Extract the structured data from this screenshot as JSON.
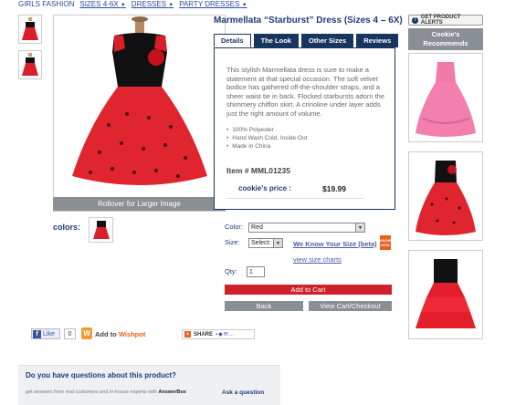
{
  "breadcrumb": {
    "items": [
      "GIRLS FASHION",
      "SIZES 4-6X",
      "DRESSES",
      "PARTY DRESSES"
    ]
  },
  "product": {
    "title": "Marmellata “Starburst” Dress (Sizes 4 – 6X)",
    "rollover": "Rollover for Larger Image",
    "colors_label": "colors:"
  },
  "tabs": [
    {
      "label": "Details",
      "active": true
    },
    {
      "label": "The Look",
      "active": false
    },
    {
      "label": "Other Sizes",
      "active": false
    },
    {
      "label": "Reviews",
      "active": false
    }
  ],
  "details": {
    "description": "This stylish Marmellata dress is sure to make a statement at that special occasion. The soft velvet bodice has gathered off-the-shoulder straps, and a sheer waist tie in back. Flocked starbursts adorn the shimmery chiffon skirt. A crinoline under layer adds just the right amount of volume.",
    "bullets": [
      "100% Polyester",
      "Hand Wash Cold, Inside Out",
      "Made in China"
    ],
    "item_number": "Item # MML01235",
    "price_label": "cookie's price :",
    "price": "$19.99"
  },
  "options": {
    "color_label": "Color:",
    "color_value": "Red",
    "size_label": "Size:",
    "size_value": "Select:",
    "size_help": "We Know Your Size (beta)",
    "size_badge": "KNOW KIDS",
    "size_charts": "view size charts",
    "qty_label": "Qty:",
    "qty_value": "1"
  },
  "buttons": {
    "add_to_cart": "Add to Cart",
    "back": "Back",
    "checkout": "View Cart/Checkout"
  },
  "recommends": {
    "alert": "GET PRODUCT ALERTS",
    "header": "Cookie's Recommends"
  },
  "social": {
    "like": "Like",
    "like_count": "0",
    "wishpot_prefix": "Add to ",
    "wishpot_brand": "Wishpot",
    "share": "SHARE"
  },
  "questions": {
    "title": "Do you have questions about this product?",
    "subtitle": "get answers from real customers and in-house experts with ",
    "subtitle_brand": "AnswerBox",
    "ask": "Ask a question"
  },
  "colors": {
    "navy": "#17365f",
    "link": "#2a4a9a",
    "cart_red": "#d0202b",
    "grey_button": "#8a8f96",
    "dress_red": "#d81f2a",
    "dress_black": "#111111",
    "dress_pink": "#f07aa8"
  }
}
